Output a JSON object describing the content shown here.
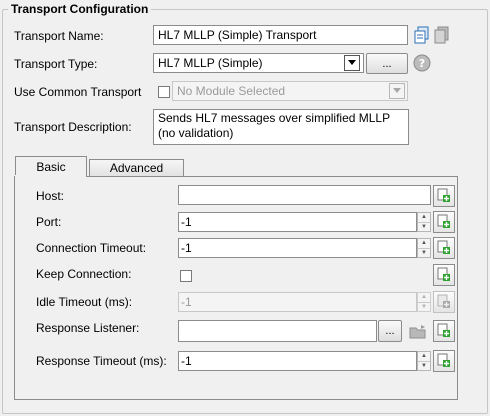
{
  "group": {
    "title": "Transport Configuration"
  },
  "transport_name": {
    "label": "Transport Name:",
    "value": "HL7 MLLP (Simple) Transport"
  },
  "transport_type": {
    "label": "Transport Type:",
    "value": "HL7 MLLP (Simple)",
    "browse_label": "..."
  },
  "use_common": {
    "label": "Use Common Transport",
    "placeholder": "No Module Selected",
    "checked": false
  },
  "description": {
    "label": "Transport Description:",
    "value": "Sends HL7 messages over simplified MLLP (no validation)"
  },
  "tabs": [
    {
      "label": "Basic",
      "active": true
    },
    {
      "label": "Advanced",
      "active": false
    }
  ],
  "basic": {
    "host": {
      "label": "Host:",
      "value": ""
    },
    "port": {
      "label": "Port:",
      "value": "-1"
    },
    "connection_timeout": {
      "label": "Connection Timeout:",
      "value": "-1"
    },
    "keep_connection": {
      "label": "Keep Connection:",
      "checked": false
    },
    "idle_timeout": {
      "label": "Idle Timeout (ms):",
      "value": "-1",
      "disabled": true
    },
    "response_listener": {
      "label": "Response Listener:",
      "value": "",
      "browse_label": "..."
    },
    "response_timeout": {
      "label": "Response Timeout (ms):",
      "value": "-1"
    }
  },
  "icons": {
    "copy": "copy-icon",
    "paste": "paste-icon",
    "help": "help-icon",
    "add": "add-variable-icon",
    "dropdown": "chevron-down-icon",
    "folder": "folder-icon"
  },
  "colors": {
    "add_green": "#2fa22f",
    "icon_blue": "#2d6fb7",
    "disabled_gray": "#a8a8a8"
  }
}
